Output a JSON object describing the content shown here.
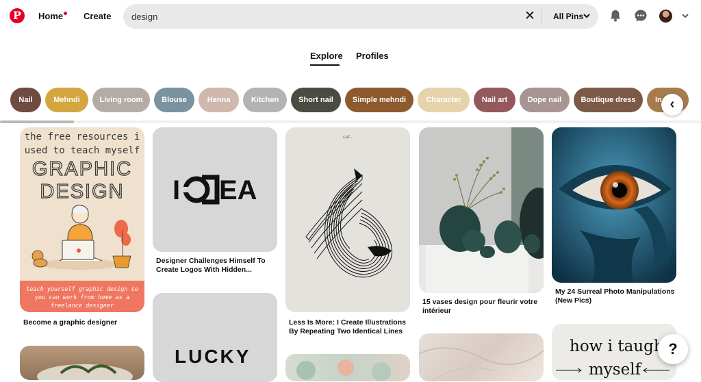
{
  "header": {
    "logo_letter": "P",
    "home_label": "Home",
    "create_label": "Create",
    "search_value": "design",
    "clear_symbol": "✕",
    "scope_label": "All Pins",
    "icons": [
      "pinterest-logo",
      "notification-dot",
      "clear-icon",
      "chevron-down-icon",
      "bell-icon",
      "chat-icon",
      "avatar",
      "chevron-down-icon"
    ]
  },
  "tabs": [
    {
      "label": "Explore",
      "active": true
    },
    {
      "label": "Profiles",
      "active": false
    }
  ],
  "chips": [
    {
      "label": "Nail",
      "color": "#6f4b43"
    },
    {
      "label": "Mehndi",
      "color": "#d3a63f"
    },
    {
      "label": "Living room",
      "color": "#b5aba5"
    },
    {
      "label": "Blouse",
      "color": "#7b93a1"
    },
    {
      "label": "Henna",
      "color": "#d0b8ae"
    },
    {
      "label": "Kitchen",
      "color": "#b4b3b2"
    },
    {
      "label": "Short nail",
      "color": "#4b4b41"
    },
    {
      "label": "Simple mehndi",
      "color": "#8d5a2e"
    },
    {
      "label": "Character",
      "color": "#e6d3aa"
    },
    {
      "label": "Nail art",
      "color": "#93595d"
    },
    {
      "label": "Dope nail",
      "color": "#a89593"
    },
    {
      "label": "Boutique dress",
      "color": "#7c5a47"
    },
    {
      "label": "In",
      "color": "#a67c4d"
    }
  ],
  "chip_scroll_icon": "chevron-left-icon",
  "chip_arrow": "‹",
  "pins": {
    "graphic": {
      "line1": "the free resources i",
      "line2": "used to teach myself",
      "line3": "GRAPHIC",
      "line4": "DESIGN",
      "footer1": "teach yourself graphic design so",
      "footer2": "you can work from home as a",
      "footer3": "freelance designer",
      "title": "Become a graphic designer"
    },
    "idea": {
      "word_left": "I",
      "word_right": "EA",
      "title": "Designer Challenges Himself To Create Logos With Hidden..."
    },
    "lucky": {
      "word": "LUCKY"
    },
    "less": {
      "caption": "cat.",
      "title": "Less Is More: I Create Illustrations By Repeating Two Identical Lines"
    },
    "vases": {
      "title": "15 vases design pour fleurir votre intérieur"
    },
    "surreal": {
      "title": "My 24 Surreal Photo Manipulations (New Pics)"
    },
    "taught": {
      "line1": "how i taught",
      "line2": "myself"
    }
  },
  "help_label": "?"
}
